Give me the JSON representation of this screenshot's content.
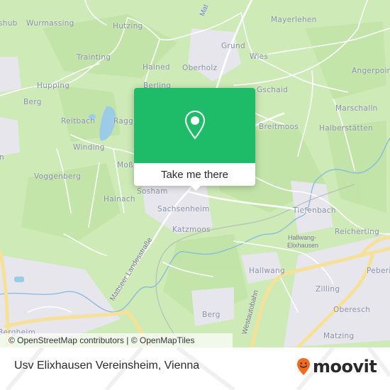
{
  "map": {
    "colors": {
      "land": "#cdeab7",
      "forest": "#c3e5aa",
      "urban": "#e8e8ee",
      "road": "#ffffff",
      "highway": "#f8e39a",
      "water": "#9ccbe8",
      "river": "#7fb6d8",
      "label": "#8a8fa6"
    },
    "places": [
      {
        "name": "shub"
      },
      {
        "name": "Wurmassing"
      },
      {
        "name": "Hutzing"
      },
      {
        "name": "Mayerlehen"
      },
      {
        "name": "Grund"
      },
      {
        "name": "Wies"
      },
      {
        "name": "Trainting"
      },
      {
        "name": "Hained"
      },
      {
        "name": "Oberholz"
      },
      {
        "name": "Angerpoint"
      },
      {
        "name": "Hupping"
      },
      {
        "name": "Berling"
      },
      {
        "name": "Gschaid"
      },
      {
        "name": "Berg"
      },
      {
        "name": "Marschalln"
      },
      {
        "name": "Reitbach"
      },
      {
        "name": "Raggi"
      },
      {
        "name": "Breitmoos"
      },
      {
        "name": "Halberstätten"
      },
      {
        "name": "n"
      },
      {
        "name": "Winding"
      },
      {
        "name": "Moß"
      },
      {
        "name": "Voggenberg"
      },
      {
        "name": "Hainach"
      },
      {
        "name": "Sosham"
      },
      {
        "name": "Sachsenheim"
      },
      {
        "name": "Tiefenbach"
      },
      {
        "name": "Katzmoos"
      },
      {
        "name": "Reicherting"
      },
      {
        "name": "Hallwang-"
      },
      {
        "name": "Elixhausen"
      },
      {
        "name": "Hallwang"
      },
      {
        "name": "Peberi"
      },
      {
        "name": "Zilling"
      },
      {
        "name": "Berg"
      },
      {
        "name": "Oberesch"
      },
      {
        "name": "Matzing"
      },
      {
        "name": "Bergheim"
      }
    ],
    "roads": [
      {
        "name": "Mattseer Landesstraße"
      },
      {
        "name": "Westautobahn"
      },
      {
        "name": "Mat"
      }
    ]
  },
  "popup": {
    "icon": "map-pin-icon",
    "button_label": "Take me there",
    "color": "#1ebb69"
  },
  "attribution": {
    "text": "© OpenStreetMap contributors | © OpenMapTiles"
  },
  "footer": {
    "title": "Usv Elixhausen Vereinsheim, Vienna",
    "logo": {
      "icon": "moovit-pin-icon",
      "text": "moovit",
      "color": "#f26b1d"
    }
  }
}
